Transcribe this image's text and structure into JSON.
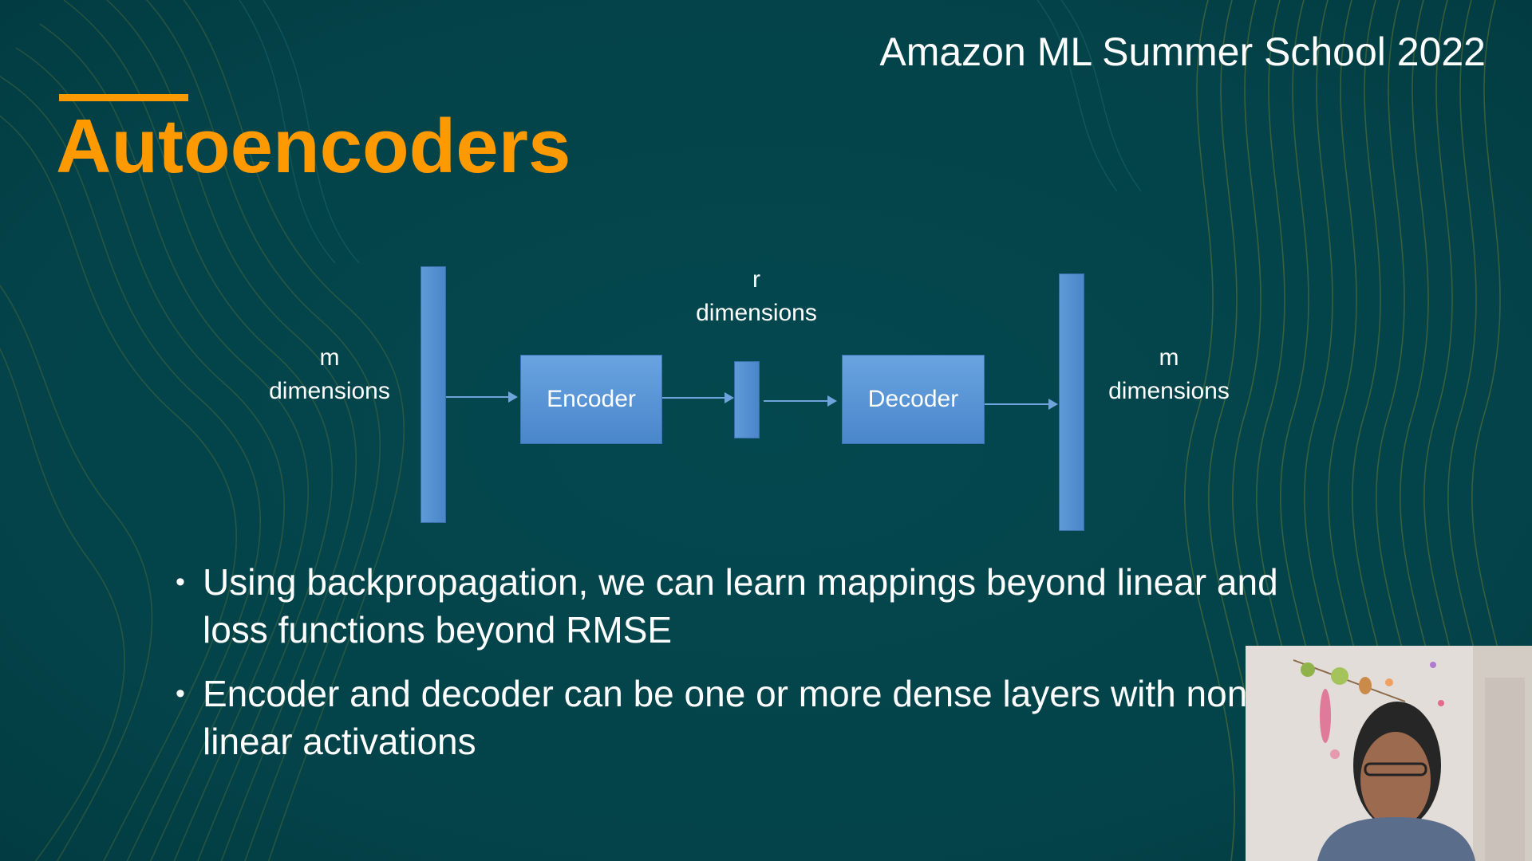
{
  "slide": {
    "event_name": "Amazon ML Summer School 2022",
    "title": "Autoencoders",
    "colors": {
      "background": "#03474d",
      "accent": "#ff9900",
      "block": "#4a86cb",
      "text": "#ffffff"
    }
  },
  "diagram": {
    "input_label": {
      "line1": "m",
      "line2": "dimensions"
    },
    "encoder_label": "Encoder",
    "latent_label": {
      "line1": "r",
      "line2": "dimensions"
    },
    "decoder_label": "Decoder",
    "output_label": {
      "line1": "m",
      "line2": "dimensions"
    }
  },
  "bullets": [
    {
      "text": "Using backpropagation, we can learn mappings beyond linear and loss functions beyond RMSE"
    },
    {
      "text": "Encoder and decoder can be one or more dense layers with non-linear activations"
    }
  ],
  "bullet_glyph": "•",
  "webcam": {
    "icon": "presenter-video-feed"
  }
}
